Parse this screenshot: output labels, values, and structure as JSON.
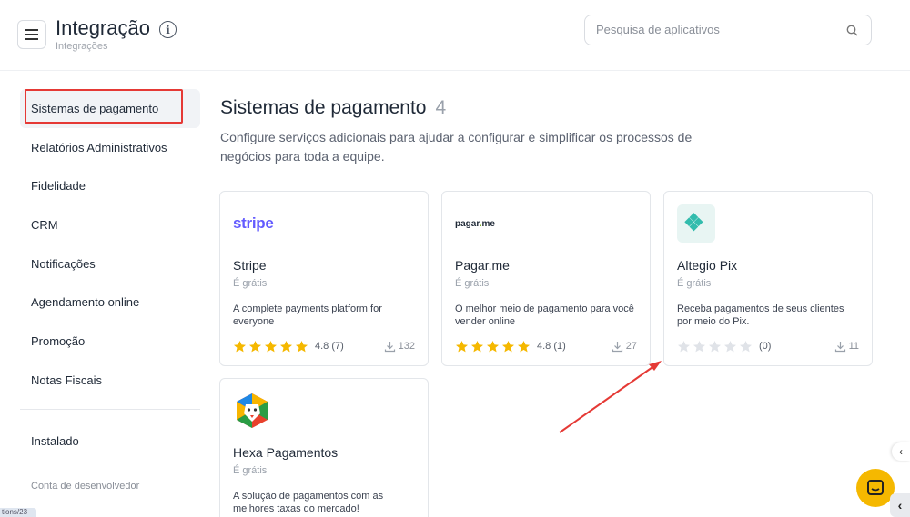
{
  "header": {
    "title": "Integração",
    "subtitle": "Integrações",
    "search_placeholder": "Pesquisa de aplicativos"
  },
  "sidebar": {
    "items": [
      {
        "label": "Sistemas de pagamento",
        "active": true
      },
      {
        "label": "Relatórios Administrativos"
      },
      {
        "label": "Fidelidade"
      },
      {
        "label": "CRM"
      },
      {
        "label": "Notificações"
      },
      {
        "label": "Agendamento online"
      },
      {
        "label": "Promoção"
      },
      {
        "label": "Notas Fiscais"
      }
    ],
    "installed": "Instalado",
    "developer_account": "Conta de desenvolvedor"
  },
  "status_url": "tions/23",
  "section": {
    "title": "Sistemas de pagamento",
    "count": "4",
    "description": "Configure serviços adicionais para ajudar a configurar e simplificar os processos de negócios para toda a equipe."
  },
  "cards": [
    {
      "logo": "stripe",
      "name": "Stripe",
      "price": "É grátis",
      "description": "A complete payments platform for everyone",
      "stars": 5,
      "rating": "4.8 (7)",
      "downloads": "132"
    },
    {
      "logo": "pagar.me",
      "name": "Pagar.me",
      "price": "É grátis",
      "description": "O melhor meio de pagamento para você vender online",
      "stars": 5,
      "rating": "4.8 (1)",
      "downloads": "27"
    },
    {
      "logo": "pix-icon",
      "name": "Altegio Pix",
      "price": "É grátis",
      "description": "Receba pagamentos de seus clientes por meio do Pix.",
      "stars": 0,
      "rating": "(0)",
      "downloads": "11"
    },
    {
      "logo": "lion-icon",
      "name": "Hexa Pagamentos",
      "price": "É grátis",
      "description": "A solução de pagamentos com as melhores taxas do mercado!"
    }
  ],
  "colors": {
    "star_filled": "#f5b800",
    "star_empty": "#e0e3e8",
    "highlight": "#e53935",
    "stripe": "#635bff",
    "pix": "#32bcad",
    "chat": "#f5b800"
  }
}
